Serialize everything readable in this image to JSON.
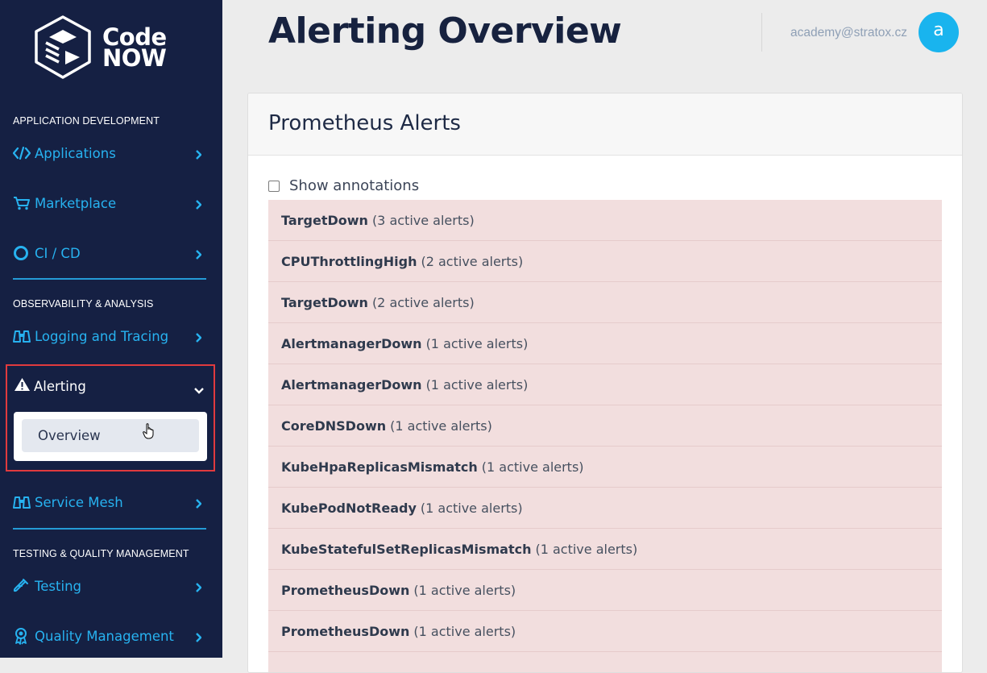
{
  "brand": {
    "line1": "Code",
    "line2": "NOW"
  },
  "sidebar": {
    "section1_title": "APPLICATION DEVELOPMENT",
    "section2_title": "OBSERVABILITY & ANALYSIS",
    "section3_title": "TESTING & QUALITY MANAGEMENT",
    "items": [
      {
        "label": "Applications",
        "icon": "code-icon"
      },
      {
        "label": "Marketplace",
        "icon": "cart-icon"
      },
      {
        "label": "CI / CD",
        "icon": "ring-icon"
      },
      {
        "label": "Logging and Tracing",
        "icon": "binoculars-icon"
      },
      {
        "label": "Alerting",
        "icon": "warning-icon"
      },
      {
        "label": "Service Mesh",
        "icon": "binoculars-icon"
      },
      {
        "label": "Testing",
        "icon": "test-tube-icon"
      },
      {
        "label": "Quality Management",
        "icon": "award-icon"
      }
    ],
    "alerting_submenu": {
      "overview": "Overview"
    }
  },
  "header": {
    "title": "Alerting Overview",
    "user_email": "academy@stratox.cz",
    "avatar_initial": "a"
  },
  "card": {
    "title": "Prometheus Alerts",
    "show_annotations_label": "Show annotations",
    "show_annotations_checked": false,
    "alerts": [
      {
        "name": "TargetDown",
        "count": "(3 active alerts)"
      },
      {
        "name": "CPUThrottlingHigh",
        "count": "(2 active alerts)"
      },
      {
        "name": "TargetDown",
        "count": "(2 active alerts)"
      },
      {
        "name": "AlertmanagerDown",
        "count": "(1 active alerts)"
      },
      {
        "name": "AlertmanagerDown",
        "count": "(1 active alerts)"
      },
      {
        "name": "CoreDNSDown",
        "count": "(1 active alerts)"
      },
      {
        "name": "KubeHpaReplicasMismatch",
        "count": "(1 active alerts)"
      },
      {
        "name": "KubePodNotReady",
        "count": "(1 active alerts)"
      },
      {
        "name": "KubeStatefulSetReplicasMismatch",
        "count": "(1 active alerts)"
      },
      {
        "name": "PrometheusDown",
        "count": "(1 active alerts)"
      },
      {
        "name": "PrometheusDown",
        "count": "(1 active alerts)"
      }
    ]
  },
  "colors": {
    "sidebar_bg": "#152043",
    "accent": "#27b2f0",
    "highlight_border": "#e03a3e",
    "alert_row_bg": "#f2dede"
  }
}
